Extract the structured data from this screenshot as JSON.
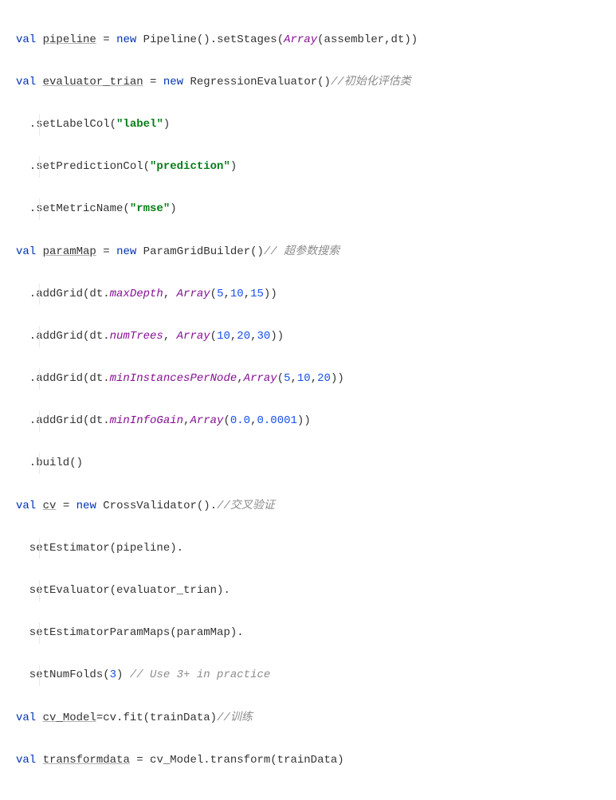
{
  "lines": {
    "l1": {
      "kw_val": "val",
      "name": "pipeline",
      "eq": " = ",
      "kw_new": "new",
      "ctor": " Pipeline().setStages(",
      "arr": "Array",
      "args": "(assembler,dt))"
    },
    "l2": {
      "kw_val": "val",
      "name": "evaluator_trian",
      "eq": " = ",
      "kw_new": "new",
      "ctor": " RegressionEvaluator()",
      "comment": "//初始化评估类"
    },
    "l3": {
      "prefix": "  .setLabelCol(",
      "str": "\"label\"",
      "suffix": ")"
    },
    "l4": {
      "prefix": "  .setPredictionCol(",
      "str": "\"prediction\"",
      "suffix": ")"
    },
    "l5": {
      "prefix": "  .setMetricName(",
      "str": "\"rmse\"",
      "suffix": ")"
    },
    "l6": {
      "kw_val": "val",
      "name": "paramMap",
      "eq": " = ",
      "kw_new": "new",
      "ctor": " ParamGridBuilder()",
      "comment": "// 超参数搜索"
    },
    "l7": {
      "prefix": "  .addGrid(dt.",
      "member": "maxDepth",
      "mid": ", ",
      "arr": "Array",
      "open": "(",
      "n1": "5",
      "c1": ",",
      "n2": "10",
      "c2": ",",
      "n3": "15",
      "close": "))"
    },
    "l8": {
      "prefix": "  .addGrid(dt.",
      "member": "numTrees",
      "mid": ", ",
      "arr": "Array",
      "open": "(",
      "n1": "10",
      "c1": ",",
      "n2": "20",
      "c2": ",",
      "n3": "30",
      "close": "))"
    },
    "l9": {
      "prefix": "  .addGrid(dt.",
      "member": "minInstancesPerNode",
      "mid": ",",
      "arr": "Array",
      "open": "(",
      "n1": "5",
      "c1": ",",
      "n2": "10",
      "c2": ",",
      "n3": "20",
      "close": "))"
    },
    "l10": {
      "prefix": "  .addGrid(dt.",
      "member": "minInfoGain",
      "mid": ",",
      "arr": "Array",
      "open": "(",
      "n1": "0.0",
      "c1": ",",
      "n2": "0.0001",
      "close": "))"
    },
    "l11": {
      "text": "  .build()"
    },
    "l12": {
      "kw_val": "val",
      "name": "cv",
      "eq": " = ",
      "kw_new": "new",
      "ctor": " CrossValidator().",
      "comment": "//交叉验证"
    },
    "l13": {
      "text": "  setEstimator(pipeline)."
    },
    "l14": {
      "text": "  setEvaluator(evaluator_trian)."
    },
    "l15": {
      "text": "  setEstimatorParamMaps(paramMap)."
    },
    "l16": {
      "prefix": "  setNumFolds(",
      "n": "3",
      "suffix": ") ",
      "comment": "// Use 3+ in practice"
    },
    "l17": {
      "kw_val": "val",
      "name": "cv_Model",
      "eq": "=cv.fit(trainData)",
      "comment": "//训练"
    },
    "l18": {
      "kw_val": "val",
      "name": "transformdata",
      "eq": " = cv_Model.transform(trainData)"
    }
  }
}
